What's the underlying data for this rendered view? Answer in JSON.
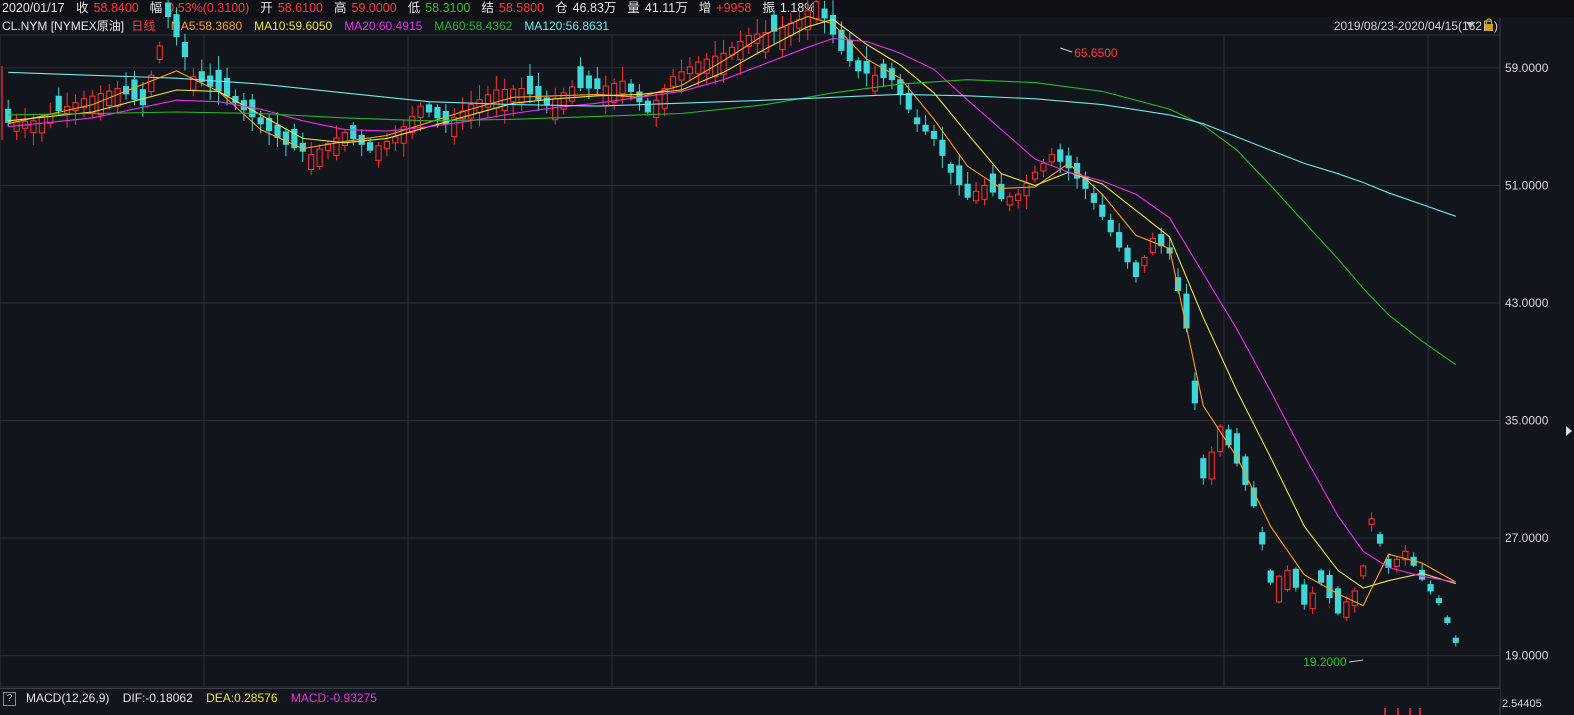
{
  "header": {
    "date": "2020/01/17",
    "fields": [
      {
        "label": "收",
        "value": "58.8400",
        "color": "red"
      },
      {
        "label": "幅",
        "value": "0.53%(0.3100)",
        "color": "red"
      },
      {
        "label": "开",
        "value": "58.6100",
        "color": "red"
      },
      {
        "label": "高",
        "value": "59.0000",
        "color": "red"
      },
      {
        "label": "低",
        "value": "58.3100",
        "color": "green"
      },
      {
        "label": "结",
        "value": "58.5800",
        "color": "red"
      },
      {
        "label": "仓",
        "value": "46.83万",
        "color": "white"
      },
      {
        "label": "量",
        "value": "41.11万",
        "color": "white"
      },
      {
        "label": "增",
        "value": "+9958",
        "color": "red"
      },
      {
        "label": "振",
        "value": "1.18%",
        "color": "white"
      }
    ]
  },
  "ma_legend": {
    "symbol": "CL.NYM",
    "market": "[NYMEX原油]",
    "period": "日线",
    "items": [
      {
        "label": "MA5:58.3680",
        "color": "#ff9f1a"
      },
      {
        "label": "MA10:59.6050",
        "color": "#f0e442"
      },
      {
        "label": "MA20:60.4915",
        "color": "#e830e8"
      },
      {
        "label": "MA60:58.4362",
        "color": "#27b827"
      },
      {
        "label": "MA120:56.8631",
        "color": "#6fe8ee"
      }
    ]
  },
  "range": {
    "label": "2019/08/23-2020/04/15(162日)"
  },
  "macd": {
    "params": "MACD(12,26,9)",
    "dif": "DIF:-0.18062",
    "dea": "DEA:0.28576",
    "macd": "MACD:-0.93275",
    "top_value": "2.54405"
  },
  "colors": {
    "up": "#ff3232",
    "down": "#3ed6d6",
    "grid": "#2a2f38"
  },
  "chart_data": {
    "type": "candlestick",
    "ylim": [
      18.7,
      60.9
    ],
    "yticks": [
      {
        "value": 59.0,
        "label": "59.0000"
      },
      {
        "value": 51.0,
        "label": "51.0000"
      },
      {
        "value": 43.0,
        "label": "43.0000"
      },
      {
        "value": 35.0,
        "label": "35.0000"
      },
      {
        "value": 27.0,
        "label": "27.0000"
      },
      {
        "value": 19.0,
        "label": "19.0000"
      }
    ],
    "annotations": [
      {
        "text": "65.6500",
        "value": 65.65,
        "index": 125,
        "color": "#ff3b3b",
        "arrow": "left"
      },
      {
        "text": "19.2000",
        "value": 19.2,
        "index": 161,
        "color": "#29c529",
        "arrow": "right"
      }
    ],
    "anchors": [
      [
        0,
        55.3,
        "down"
      ],
      [
        3,
        55.4,
        "up"
      ],
      [
        6,
        56.1,
        "down"
      ],
      [
        9,
        56.9,
        "up"
      ],
      [
        13,
        57.6,
        "up"
      ],
      [
        16,
        56.5,
        "down"
      ],
      [
        19,
        62.5,
        "down"
      ],
      [
        22,
        58.4,
        "up"
      ],
      [
        26,
        57.1,
        "down"
      ],
      [
        30,
        55.2,
        "down"
      ],
      [
        33,
        53.8,
        "down"
      ],
      [
        36,
        53.1,
        "up"
      ],
      [
        40,
        54.6,
        "up"
      ],
      [
        43,
        53.4,
        "down"
      ],
      [
        46,
        54.3,
        "up"
      ],
      [
        49,
        56.4,
        "up"
      ],
      [
        52,
        55.2,
        "down"
      ],
      [
        55,
        56.5,
        "up"
      ],
      [
        58,
        57.5,
        "up"
      ],
      [
        61,
        57.6,
        "up"
      ],
      [
        64,
        56.5,
        "down"
      ],
      [
        67,
        57.7,
        "up"
      ],
      [
        70,
        57.6,
        "down"
      ],
      [
        73,
        58.1,
        "up"
      ],
      [
        76,
        56.0,
        "down"
      ],
      [
        79,
        58.4,
        "up"
      ],
      [
        82,
        59.4,
        "up"
      ],
      [
        85,
        60.0,
        "up"
      ],
      [
        88,
        61.2,
        "up"
      ],
      [
        91,
        61.5,
        "down"
      ],
      [
        94,
        62.3,
        "up"
      ],
      [
        96,
        63.5,
        "up"
      ],
      [
        99,
        60.2,
        "down"
      ],
      [
        101,
        58.8,
        "down"
      ],
      [
        103,
        58.5,
        "up"
      ],
      [
        105,
        58.2,
        "down"
      ],
      [
        108,
        55.2,
        "down"
      ],
      [
        110,
        54.2,
        "down"
      ],
      [
        112,
        51.9,
        "down"
      ],
      [
        114,
        50.2,
        "down"
      ],
      [
        116,
        51.0,
        "up"
      ],
      [
        118,
        50.1,
        "down"
      ],
      [
        120,
        50.4,
        "up"
      ],
      [
        122,
        51.9,
        "up"
      ],
      [
        124,
        53.1,
        "up"
      ],
      [
        126,
        52.2,
        "down"
      ],
      [
        128,
        50.8,
        "down"
      ],
      [
        130,
        48.9,
        "down"
      ],
      [
        132,
        46.8,
        "down"
      ],
      [
        134,
        44.8,
        "down"
      ],
      [
        136,
        47.4,
        "up"
      ],
      [
        138,
        46.4,
        "down"
      ],
      [
        140,
        41.3,
        "down"
      ],
      [
        142,
        31.1,
        "down"
      ],
      [
        144,
        34.6,
        "up"
      ],
      [
        146,
        32.1,
        "down"
      ],
      [
        148,
        29.2,
        "down"
      ],
      [
        150,
        24.0,
        "down"
      ],
      [
        152,
        24.8,
        "up"
      ],
      [
        154,
        22.5,
        "down"
      ],
      [
        156,
        24.0,
        "down"
      ],
      [
        158,
        21.9,
        "down"
      ],
      [
        160,
        23.4,
        "up"
      ],
      [
        161,
        25.1,
        "up"
      ],
      [
        162,
        28.3,
        "up"
      ],
      [
        164,
        25.0,
        "down"
      ],
      [
        166,
        26.1,
        "up"
      ],
      [
        168,
        24.2,
        "down"
      ],
      [
        170,
        22.6,
        "down"
      ],
      [
        172,
        19.9,
        "down"
      ]
    ],
    "series": [
      {
        "name": "MA5",
        "color": "#ff9f1a",
        "points": [
          [
            0,
            55.2
          ],
          [
            10,
            56.5
          ],
          [
            20,
            58.8
          ],
          [
            25,
            57.4
          ],
          [
            30,
            54.8
          ],
          [
            35,
            53.5
          ],
          [
            40,
            54.0
          ],
          [
            45,
            54.4
          ],
          [
            50,
            55.3
          ],
          [
            55,
            56.2
          ],
          [
            60,
            57.0
          ],
          [
            65,
            57.1
          ],
          [
            70,
            57.2
          ],
          [
            75,
            57.0
          ],
          [
            80,
            57.8
          ],
          [
            85,
            59.5
          ],
          [
            90,
            61.3
          ],
          [
            95,
            62.5
          ],
          [
            98,
            62.0
          ],
          [
            102,
            59.6
          ],
          [
            106,
            58.3
          ],
          [
            110,
            55.5
          ],
          [
            114,
            52.3
          ],
          [
            118,
            50.8
          ],
          [
            122,
            50.9
          ],
          [
            126,
            52.5
          ],
          [
            130,
            50.4
          ],
          [
            134,
            47.6
          ],
          [
            138,
            46.7
          ],
          [
            142,
            36.0
          ],
          [
            146,
            32.5
          ],
          [
            150,
            27.8
          ],
          [
            154,
            24.5
          ],
          [
            158,
            23.2
          ],
          [
            161,
            22.4
          ],
          [
            164,
            25.9
          ],
          [
            168,
            25.3
          ],
          [
            172,
            24.0
          ]
        ]
      },
      {
        "name": "MA10",
        "color": "#f0e442",
        "points": [
          [
            0,
            55.4
          ],
          [
            10,
            56.0
          ],
          [
            20,
            57.5
          ],
          [
            25,
            57.4
          ],
          [
            30,
            55.8
          ],
          [
            35,
            54.2
          ],
          [
            40,
            53.9
          ],
          [
            45,
            54.2
          ],
          [
            50,
            55.0
          ],
          [
            55,
            55.8
          ],
          [
            60,
            56.6
          ],
          [
            65,
            56.9
          ],
          [
            70,
            57.1
          ],
          [
            75,
            57.2
          ],
          [
            80,
            57.5
          ],
          [
            85,
            58.7
          ],
          [
            90,
            60.3
          ],
          [
            95,
            61.8
          ],
          [
            98,
            62.3
          ],
          [
            102,
            60.6
          ],
          [
            106,
            59.2
          ],
          [
            110,
            57.3
          ],
          [
            114,
            54.5
          ],
          [
            118,
            51.8
          ],
          [
            122,
            51.0
          ],
          [
            126,
            51.9
          ],
          [
            130,
            51.1
          ],
          [
            134,
            49.3
          ],
          [
            138,
            47.5
          ],
          [
            142,
            42.0
          ],
          [
            146,
            37.0
          ],
          [
            150,
            32.5
          ],
          [
            154,
            27.8
          ],
          [
            158,
            24.8
          ],
          [
            161,
            23.6
          ],
          [
            164,
            24.1
          ],
          [
            168,
            24.6
          ],
          [
            172,
            23.9
          ]
        ]
      },
      {
        "name": "MA20",
        "color": "#e830e8",
        "points": [
          [
            0,
            55.0
          ],
          [
            10,
            55.6
          ],
          [
            20,
            56.8
          ],
          [
            25,
            56.7
          ],
          [
            30,
            56.2
          ],
          [
            35,
            55.4
          ],
          [
            40,
            54.8
          ],
          [
            45,
            54.7
          ],
          [
            50,
            55.0
          ],
          [
            55,
            55.4
          ],
          [
            60,
            55.9
          ],
          [
            65,
            56.3
          ],
          [
            70,
            56.6
          ],
          [
            75,
            57.0
          ],
          [
            80,
            57.4
          ],
          [
            85,
            58.2
          ],
          [
            90,
            59.3
          ],
          [
            95,
            60.4
          ],
          [
            98,
            61.0
          ],
          [
            102,
            60.8
          ],
          [
            106,
            60.0
          ],
          [
            110,
            58.9
          ],
          [
            114,
            56.8
          ],
          [
            118,
            54.8
          ],
          [
            122,
            52.8
          ],
          [
            126,
            51.9
          ],
          [
            130,
            51.3
          ],
          [
            134,
            50.4
          ],
          [
            138,
            48.8
          ],
          [
            142,
            45.0
          ],
          [
            146,
            41.2
          ],
          [
            150,
            37.0
          ],
          [
            154,
            32.6
          ],
          [
            158,
            28.5
          ],
          [
            161,
            26.1
          ],
          [
            164,
            25.0
          ],
          [
            168,
            24.4
          ],
          [
            172,
            24.0
          ]
        ]
      },
      {
        "name": "MA60",
        "color": "#27b827",
        "points": [
          [
            0,
            55.8
          ],
          [
            10,
            55.9
          ],
          [
            20,
            56.0
          ],
          [
            30,
            55.9
          ],
          [
            40,
            55.6
          ],
          [
            50,
            55.4
          ],
          [
            60,
            55.5
          ],
          [
            70,
            55.7
          ],
          [
            80,
            55.9
          ],
          [
            90,
            56.5
          ],
          [
            98,
            57.3
          ],
          [
            106,
            57.9
          ],
          [
            114,
            58.2
          ],
          [
            122,
            58.0
          ],
          [
            130,
            57.4
          ],
          [
            138,
            56.2
          ],
          [
            142,
            55.1
          ],
          [
            146,
            53.4
          ],
          [
            150,
            51.0
          ],
          [
            154,
            48.5
          ],
          [
            158,
            46.0
          ],
          [
            161,
            44.0
          ],
          [
            164,
            42.2
          ],
          [
            168,
            40.4
          ],
          [
            172,
            38.8
          ]
        ]
      },
      {
        "name": "MA120",
        "color": "#6fe8ee",
        "points": [
          [
            0,
            58.7
          ],
          [
            10,
            58.5
          ],
          [
            20,
            58.3
          ],
          [
            30,
            57.9
          ],
          [
            40,
            57.3
          ],
          [
            50,
            56.7
          ],
          [
            60,
            56.5
          ],
          [
            70,
            56.4
          ],
          [
            80,
            56.6
          ],
          [
            90,
            56.8
          ],
          [
            98,
            57.0
          ],
          [
            106,
            57.2
          ],
          [
            114,
            57.1
          ],
          [
            122,
            56.9
          ],
          [
            130,
            56.5
          ],
          [
            138,
            55.8
          ],
          [
            142,
            55.2
          ],
          [
            146,
            54.3
          ],
          [
            150,
            53.4
          ],
          [
            154,
            52.5
          ],
          [
            158,
            51.8
          ],
          [
            161,
            51.2
          ],
          [
            164,
            50.5
          ],
          [
            168,
            49.7
          ],
          [
            172,
            48.9
          ]
        ]
      }
    ]
  }
}
